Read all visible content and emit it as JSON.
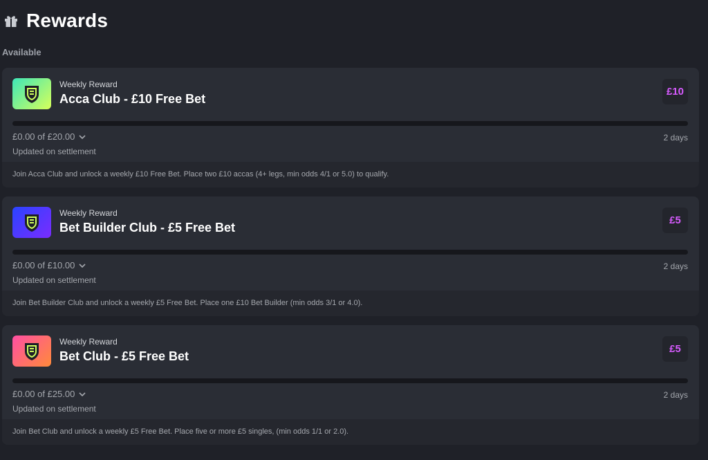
{
  "header": {
    "title": "Rewards",
    "icon": "gift-icon"
  },
  "section": {
    "label": "Available"
  },
  "colors": {
    "accent": "#d75bff",
    "track": "#16171c"
  },
  "cards": [
    {
      "kicker": "Weekly Reward",
      "title": "Acca Club - £10 Free Bet",
      "amount": "£10",
      "progress_text": "£0.00 of £20.00",
      "progress_fraction": 0,
      "days": "2 days",
      "updated": "Updated on settlement",
      "description": "Join Acca Club and unlock a weekly £10 Free Bet. Place two £10 accas (4+ legs, min odds 4/1 or 5.0) to qualify.",
      "thumb_gradient": [
        "#3ee7b8",
        "#d7ff5a"
      ]
    },
    {
      "kicker": "Weekly Reward",
      "title": "Bet Builder Club - £5 Free Bet",
      "amount": "£5",
      "progress_text": "£0.00 of £10.00",
      "progress_fraction": 0,
      "days": "2 days",
      "updated": "Updated on settlement",
      "description": "Join Bet Builder Club and unlock a weekly £5 Free Bet. Place one £10 Bet Builder (min odds 3/1 or 4.0).",
      "thumb_gradient": [
        "#2a44ff",
        "#7a2cff"
      ]
    },
    {
      "kicker": "Weekly Reward",
      "title": "Bet Club - £5 Free Bet",
      "amount": "£5",
      "progress_text": "£0.00 of £25.00",
      "progress_fraction": 0,
      "days": "2 days",
      "updated": "Updated on settlement",
      "description": "Join Bet Club and unlock a weekly £5 Free Bet. Place five or more £5 singles, (min odds 1/1 or 2.0).",
      "thumb_gradient": [
        "#ff4fa3",
        "#ff8a3a"
      ]
    }
  ]
}
